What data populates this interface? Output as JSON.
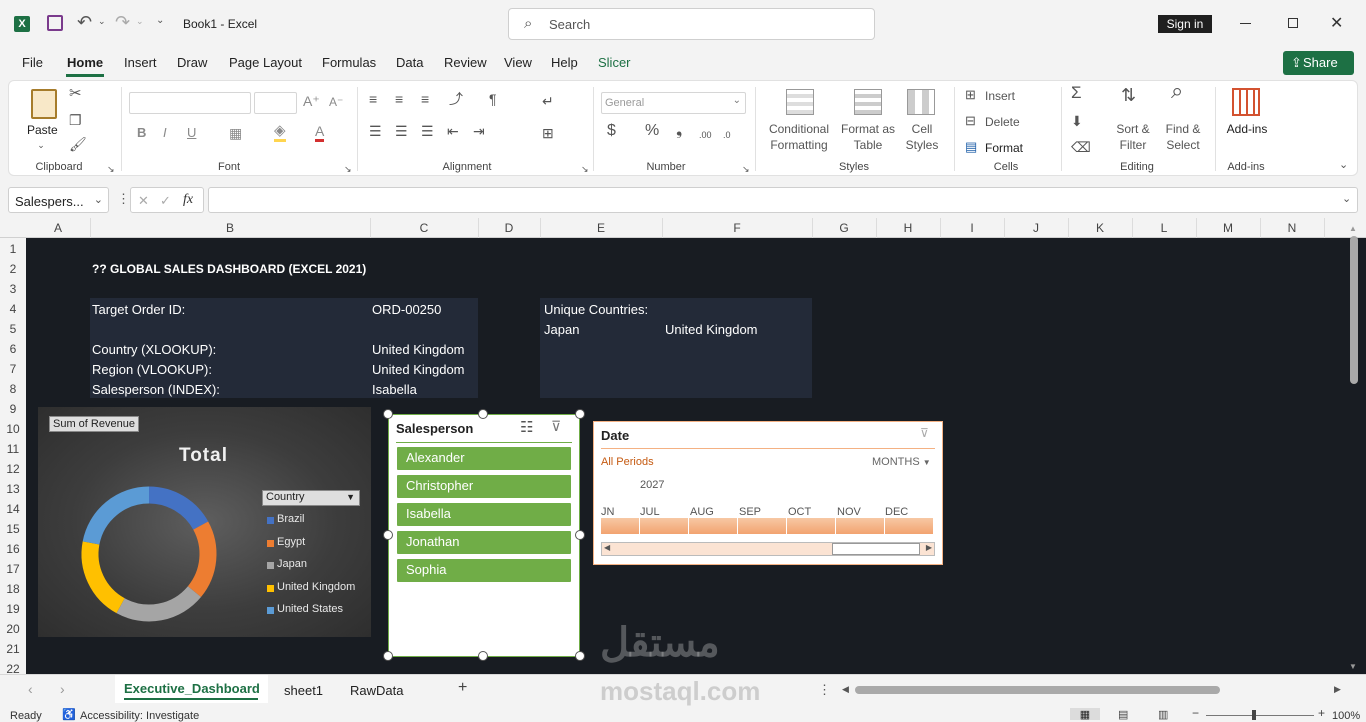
{
  "window": {
    "title": "Book1 - Excel",
    "search_placeholder": "Search",
    "sign_in": "Sign in"
  },
  "tabs": [
    "File",
    "Home",
    "Insert",
    "Draw",
    "Page Layout",
    "Formulas",
    "Data",
    "Review",
    "View",
    "Help",
    "Slicer"
  ],
  "share": "Share",
  "ribbon": {
    "clipboard": {
      "paste": "Paste",
      "label": "Clipboard"
    },
    "font": {
      "label": "Font"
    },
    "alignment": {
      "label": "Alignment"
    },
    "number": {
      "format": "General",
      "label": "Number"
    },
    "styles": {
      "conditional1": "Conditional",
      "conditional2": "Formatting",
      "format_as1": "Format as",
      "format_as2": "Table",
      "cell1": "Cell",
      "cell2": "Styles",
      "label": "Styles"
    },
    "cells": {
      "insert": "Insert",
      "delete": "Delete",
      "format": "Format",
      "label": "Cells"
    },
    "editing": {
      "sort1": "Sort &",
      "sort2": "Filter",
      "find1": "Find &",
      "find2": "Select",
      "label": "Editing"
    },
    "addins": {
      "addins": "Add-ins",
      "label": "Add-ins"
    }
  },
  "formula_bar": {
    "name_box": "Salespers...",
    "fx": "fx",
    "formula": ""
  },
  "columns": [
    "A",
    "B",
    "C",
    "D",
    "E",
    "F",
    "G",
    "H",
    "I",
    "J",
    "K",
    "L",
    "M",
    "N"
  ],
  "rows": [
    "1",
    "2",
    "3",
    "4",
    "5",
    "6",
    "7",
    "8",
    "9",
    "10",
    "11",
    "12",
    "13",
    "14",
    "15",
    "16",
    "17",
    "18",
    "19",
    "20",
    "21",
    "22"
  ],
  "sheet": {
    "title": "?? GLOBAL SALES DASHBOARD (EXCEL 2021)",
    "target_label": "Target Order ID:",
    "target_value": "ORD-00250",
    "country_label": "Country (XLOOKUP):",
    "country_value": "United Kingdom",
    "region_label": "Region (VLOOKUP):",
    "region_value": "United Kingdom",
    "salesperson_label": "Salesperson (INDEX):",
    "salesperson_value": "Isabella",
    "unique_label": "Unique Countries:",
    "unique_1": "Japan",
    "unique_2": "United Kingdom"
  },
  "pivot_chart": {
    "field_button": "Sum of Revenue",
    "title": "Total",
    "legend_field": "Country",
    "chart_data": {
      "type": "pie",
      "title": "Total",
      "categories": [
        "Brazil",
        "Egypt",
        "Japan",
        "United Kingdom",
        "United States"
      ],
      "values": [
        17,
        19,
        22,
        20,
        22
      ],
      "colors": [
        "#4472c4",
        "#ed7d31",
        "#a5a5a5",
        "#ffc000",
        "#5b9bd5"
      ]
    }
  },
  "slicer": {
    "title": "Salesperson",
    "items": [
      "Alexander",
      "Christopher",
      "Isabella",
      "Jonathan",
      "Sophia"
    ]
  },
  "timeline": {
    "title": "Date",
    "all_periods": "All Periods",
    "unit": "MONTHS",
    "year": "2027",
    "months": [
      "JN",
      "JUL",
      "AUG",
      "SEP",
      "OCT",
      "NOV",
      "DEC"
    ]
  },
  "sheets": [
    "Executive_Dashboard",
    "sheet1",
    "RawData"
  ],
  "status": {
    "ready": "Ready",
    "accessibility": "Accessibility: Investigate",
    "zoom": "100%"
  },
  "watermark": {
    "arabic": "مستقل",
    "latin": "mostaql.com"
  }
}
